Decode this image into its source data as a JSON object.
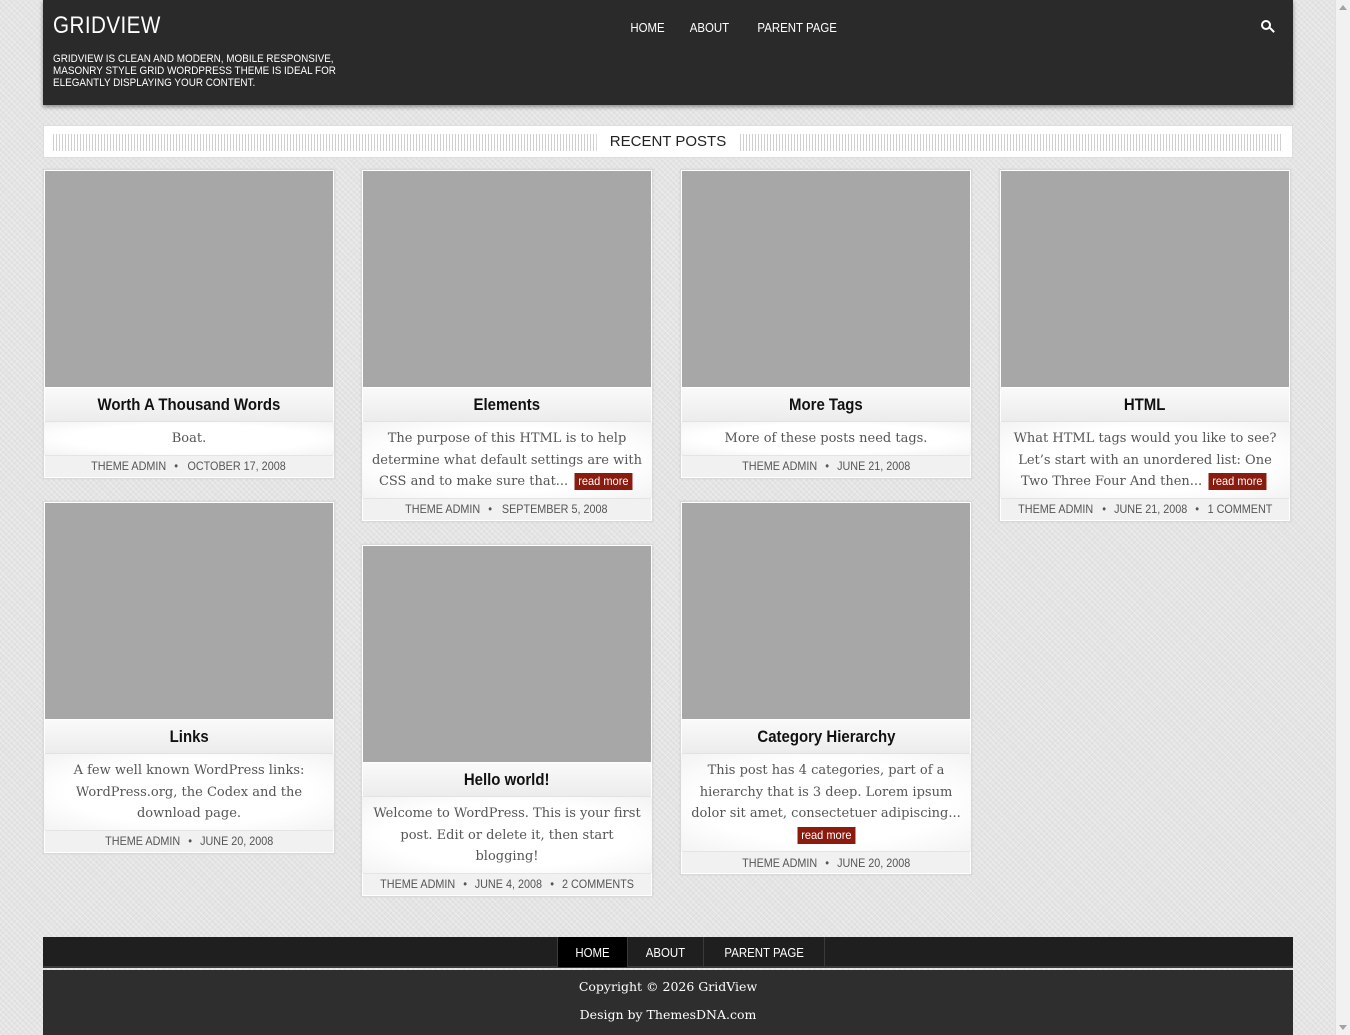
{
  "site": {
    "title": "GRIDVIEW",
    "description": "GRIDVIEW IS CLEAN AND MODERN, MOBILE RESPONSIVE, MASONRY STYLE GRID WORDPRESS THEME IS IDEAL FOR ELEGANTLY DISPLAYING YOUR CONTENT."
  },
  "nav": {
    "items": [
      {
        "label": "HOME"
      },
      {
        "label": "ABOUT"
      },
      {
        "label": "PARENT PAGE"
      }
    ],
    "search_icon": "search-icon"
  },
  "section": {
    "heading": "RECENT POSTS"
  },
  "read_more_label": "read more",
  "posts": [
    {
      "title": "Worth A Thousand Words",
      "excerpt": "Boat.",
      "author": "THEME ADMIN",
      "date": "OCTOBER 17, 2008",
      "comments": ""
    },
    {
      "title": "Elements",
      "excerpt": "The purpose of this HTML is to help determine what default settings are with CSS and to make sure that...",
      "author": "THEME ADMIN",
      "date": "SEPTEMBER 5, 2008",
      "comments": ""
    },
    {
      "title": "More Tags",
      "excerpt": "More of these posts need tags.",
      "author": "THEME ADMIN",
      "date": "JUNE 21, 2008",
      "comments": ""
    },
    {
      "title": "HTML",
      "excerpt": "What HTML tags would you like to see? Let’s start with an unordered list: One Two Three Four And then...",
      "author": "THEME ADMIN",
      "date": "JUNE 21, 2008",
      "comments": "1 COMMENT"
    },
    {
      "title": "Links",
      "excerpt": "A few well known WordPress links: WordPress.org, the Codex and the download page.",
      "author": "THEME ADMIN",
      "date": "JUNE 20, 2008",
      "comments": ""
    },
    {
      "title": "Hello world!",
      "excerpt": "Welcome to WordPress. This is your first post. Edit or delete it, then start blogging!",
      "author": "THEME ADMIN",
      "date": "JUNE 4, 2008",
      "comments": "2 COMMENTS"
    },
    {
      "title": "Category Hierarchy",
      "excerpt": "This post has 4 categories, part of a hierarchy that is 3 deep. Lorem ipsum dolor sit amet, consectetuer adipiscing...",
      "author": "THEME ADMIN",
      "date": "JUNE 20, 2008",
      "comments": ""
    }
  ],
  "footer": {
    "menu": [
      {
        "label": "HOME"
      },
      {
        "label": "ABOUT"
      },
      {
        "label": "PARENT PAGE"
      }
    ],
    "copyright": "Copyright © 2026 GridView",
    "credit": "Design by ThemesDNA.com"
  },
  "colors": {
    "header_bg": "#2a2a2a",
    "read_more_bg": "#8b1a0f",
    "thumb_placeholder": "#a7a7a7"
  }
}
